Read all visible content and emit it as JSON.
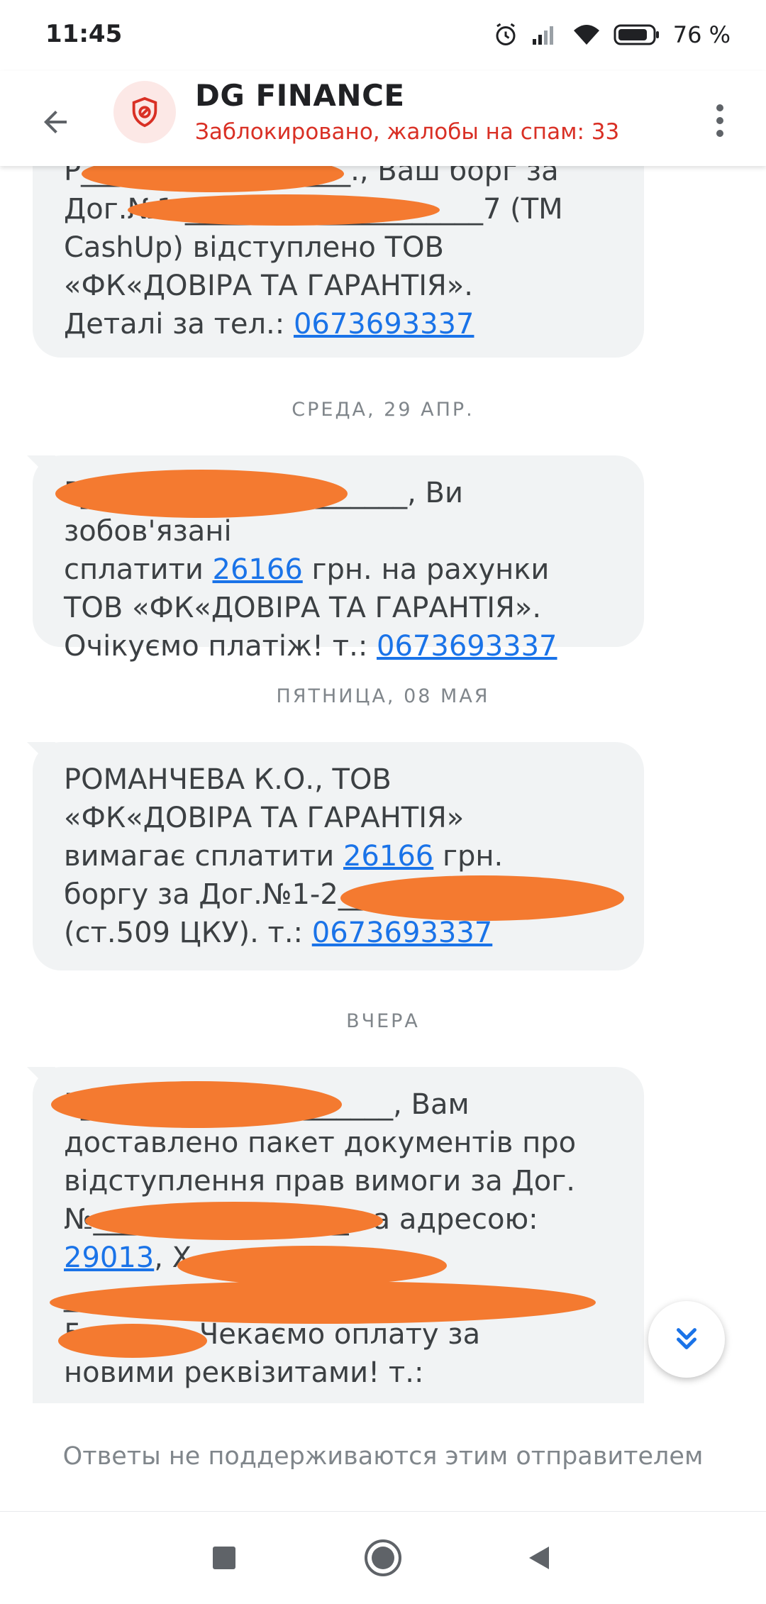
{
  "status": {
    "time": "11:45",
    "battery": "76 %"
  },
  "header": {
    "sender": "DG FINANCE",
    "subtitle": "Заблокировано, жалобы на спам: 33"
  },
  "messages": [
    {
      "lines": [
        "Р",
        "., Ваш борг за",
        "Дог.№1-",
        "7 (ТМ",
        "CashUp) відступлено ТОВ",
        "«ФК«ДОВІРА ТА ГАРАНТІЯ».",
        "Деталі за тел.: "
      ],
      "phone": "0673693337"
    },
    {
      "date": "СРЕДА, 29 АПР.",
      "line1_tail": ", Ви зобов'язані",
      "line2_pre": "сплатити ",
      "amount": "26166",
      "line2_post": " грн. на рахунки",
      "line3": "ТОВ «ФК«ДОВІРА ТА ГАРАНТІЯ».",
      "line4_pre": "Очікуємо платіж! т.: ",
      "phone": "0673693337"
    },
    {
      "date": "ПЯТНИЦА, 08 МАЯ",
      "line1": "РОМАНЧЕВА К.О., ТОВ",
      "line2": "«ФК«ДОВІРА ТА ГАРАНТІЯ»",
      "line3_pre": "вимагає сплатити ",
      "amount": "26166",
      "line3_post": " грн.",
      "line4": "боргу за Дог.№1-2",
      "line5_pre": "(ст.509 ЦКУ). т.: ",
      "phone": "0673693337"
    },
    {
      "date": "ВЧЕРА",
      "line1_tail": ", Вам",
      "line2": "доставлено пакет документів про",
      "line3": "відступлення прав вимоги за Дог.",
      "line4_pre": "№",
      "line4_post": " за адресою:",
      "zip": "29013",
      "line5_post": ", Х",
      "line7_pre": "5",
      "line7_post": ". Чекаємо оплату за",
      "line8": "новими реквізитами! т.:"
    }
  ],
  "footer": {
    "no_reply": "Ответы не поддерживаются этим отправителем"
  },
  "icons": {
    "back": "arrow-back-icon",
    "avatar": "shield-icon",
    "more": "more-vert-icon",
    "scroll": "double-chevron-down-icon",
    "nav_recents": "square-icon",
    "nav_home": "circle-icon",
    "nav_back": "triangle-icon"
  },
  "colors": {
    "link": "#1a73e8",
    "spam_warning": "#d93025",
    "bubble": "#f1f3f4",
    "redaction": "#f47a30"
  }
}
